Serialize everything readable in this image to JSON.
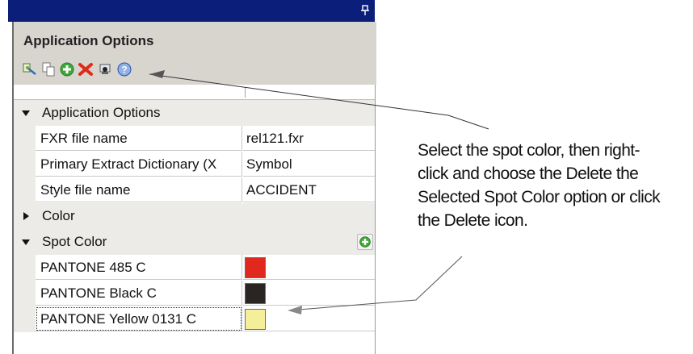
{
  "panel": {
    "title": "Application Options",
    "pin_icon": "pin-icon"
  },
  "toolbar": {
    "icons": [
      "properties-icon",
      "copy-icon",
      "add-icon",
      "delete-icon",
      "preview-icon",
      "help-icon"
    ]
  },
  "grid": {
    "category_app": "Application Options",
    "rows": [
      {
        "name": "FXR file name",
        "value": "rel121.fxr"
      },
      {
        "name": "Primary Extract Dictionary (X",
        "value": "Symbol"
      },
      {
        "name": "Style file name",
        "value": "ACCIDENT"
      }
    ],
    "category_color": "Color",
    "category_spot": "Spot Color",
    "spot_colors": [
      {
        "name": "PANTONE 485 C",
        "color": "#e0281e"
      },
      {
        "name": "PANTONE Black C",
        "color": "#2a2522"
      },
      {
        "name": "PANTONE Yellow 0131 C",
        "color": "#f5ee9a"
      }
    ]
  },
  "annotation": {
    "lines": [
      "Select the spot color, then right-",
      "click and choose the Delete the",
      "Selected Spot Color option or click",
      "the Delete icon."
    ]
  },
  "colors": {
    "titlebar": "#0b1f7a",
    "panel_bg": "#d8d5cf",
    "category_bg": "#ecebe7"
  }
}
